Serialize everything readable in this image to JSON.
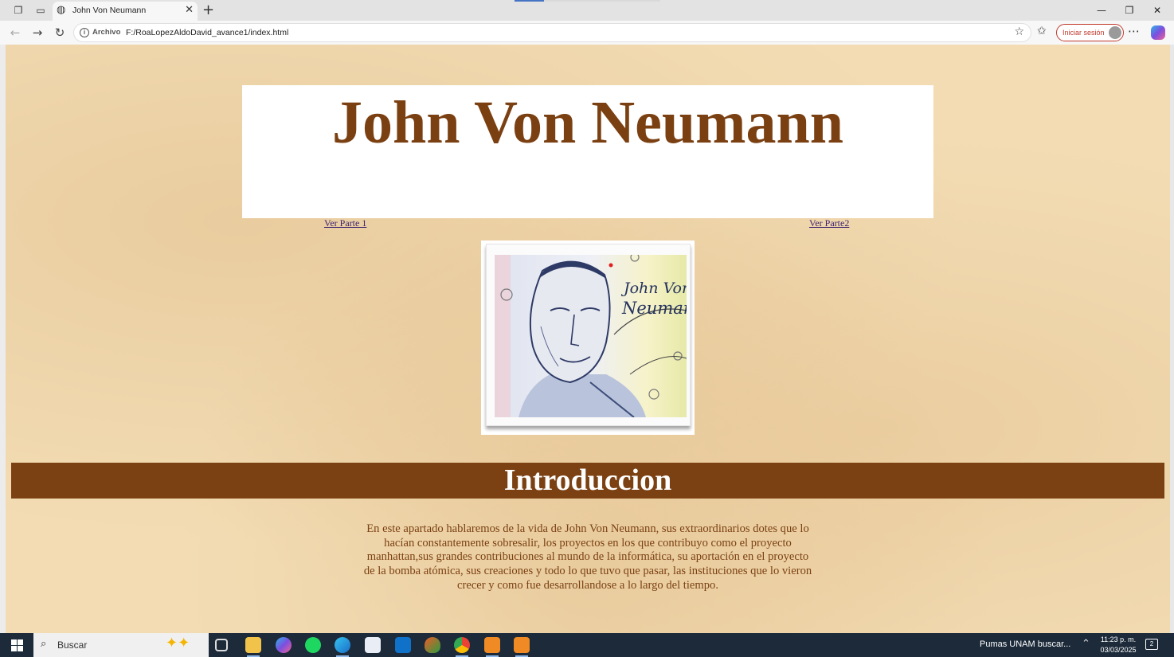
{
  "browser": {
    "tab_title": "John Von Neumann",
    "url_badge": "Archivo",
    "url": "F:/RoaLopezAldoDavid_avance1/index.html",
    "signin_label": "Iniciar sesión"
  },
  "page": {
    "title": "John Von Neumann",
    "link_left": "Ver Parte 1",
    "link_right": "Ver Parte2",
    "section_heading": "Introduccion",
    "intro_paragraph": "En este apartado hablaremos de la vida de John Von Neumann, sus extraordinarios dotes que lo hacían constantemente sobresalir, los proyectos en los que contribuyo como el proyecto manhattan,sus grandes contribuciones al mundo de la informática, su aportación en el proyecto de la bomba atómica, sus creaciones y todo lo que tuvo que pasar, las instituciones que lo vieron crecer y como fue desarrollandose a lo largo del tiempo.",
    "portrait_caption_line1": "John Von",
    "portrait_caption_line2": "Neumann"
  },
  "taskbar": {
    "search_placeholder": "Buscar",
    "news": "Pumas UNAM buscar...",
    "time": "11:23 p. m.",
    "date": "03/03/2025",
    "notification_count": "2"
  },
  "colors": {
    "brown": "#7b4113",
    "link": "#3b1f6e",
    "parchment": "#f3dcb4"
  }
}
